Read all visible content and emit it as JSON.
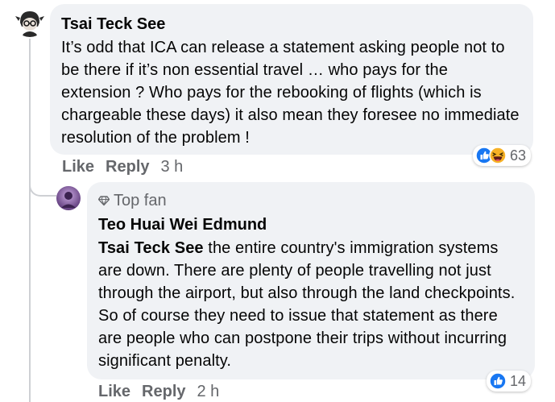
{
  "comment": {
    "author": "Tsai Teck See",
    "text": "It’s odd that ICA can release a statement asking people not to be there if it’s non essential travel … who pays for the extension ? Who pays for the rebooking of flights (which is chargeable these days) it also mean they foresee no immediate resolution of the problem !",
    "actions": {
      "like": "Like",
      "reply": "Reply",
      "time": "3 h"
    },
    "reactions": {
      "count": "63",
      "icons": [
        "like-icon",
        "haha-icon"
      ]
    }
  },
  "reply": {
    "badge": "Top fan",
    "author": "Teo Huai Wei Edmund",
    "mention": "Tsai Teck See",
    "text": " the entire country's immigration systems are down. There are plenty of people travelling not just through the airport, but also through the land checkpoints. So of course they need to issue that statement as there are people who can postpone their trips without incurring significant penalty.",
    "actions": {
      "like": "Like",
      "reply": "Reply",
      "time": "2 h"
    },
    "reactions": {
      "count": "14",
      "icons": [
        "like-icon"
      ]
    }
  },
  "colors": {
    "bubble": "#f0f2f5",
    "secondary_text": "#65676b",
    "like_blue": "#1877f2",
    "haha_yellow": "#f7b125"
  }
}
